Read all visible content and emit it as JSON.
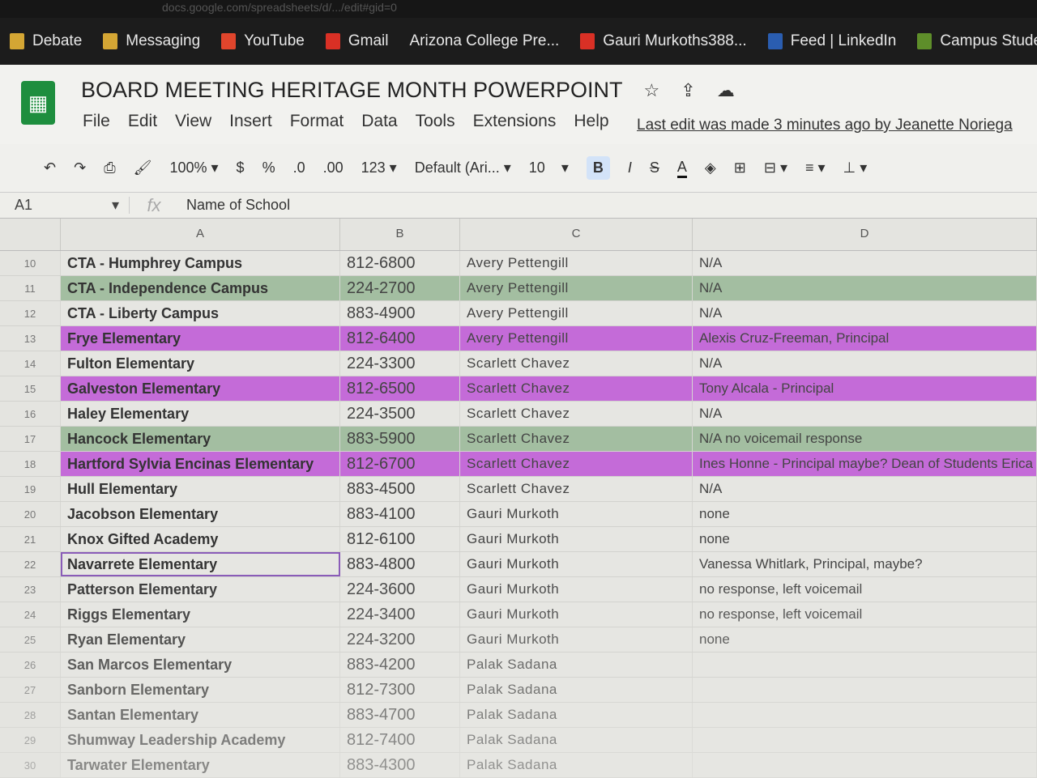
{
  "browser": {
    "url": "docs.google.com/spreadsheets/d/.../edit#gid=0",
    "bookmarks": [
      {
        "label": "Debate",
        "icon": "folder-icon",
        "color": "#d4a634"
      },
      {
        "label": "Messaging",
        "icon": "folder-icon",
        "color": "#d4a634"
      },
      {
        "label": "YouTube",
        "icon": "youtube-icon",
        "color": "#e0452c"
      },
      {
        "label": "Gmail",
        "icon": "gmail-icon",
        "color": "#d93025"
      },
      {
        "label": "Arizona College Pre...",
        "icon": "",
        "color": ""
      },
      {
        "label": "Gauri Murkoths388...",
        "icon": "gmail-icon",
        "color": "#d93025"
      },
      {
        "label": "Feed | LinkedIn",
        "icon": "linkedin-icon",
        "color": "#2a5db0"
      },
      {
        "label": "Campus Stude",
        "icon": "campus-icon",
        "color": "#5e8e2a"
      }
    ]
  },
  "doc": {
    "title": "BOARD MEETING HERITAGE MONTH POWERPOINT",
    "menu": [
      "File",
      "Edit",
      "View",
      "Insert",
      "Format",
      "Data",
      "Tools",
      "Extensions",
      "Help"
    ],
    "last_edit": "Last edit was made 3 minutes ago by Jeanette Noriega"
  },
  "toolbar": {
    "zoom": "100%",
    "currency": "$",
    "percent": "%",
    "dec_less": ".0",
    "dec_more": ".00",
    "format": "123",
    "font": "Default (Ari...",
    "size": "10",
    "bold": "B",
    "italic": "I",
    "strike": "S",
    "textcolor": "A"
  },
  "formula": {
    "cell": "A1",
    "fx": "fx",
    "value": "Name of School"
  },
  "columns": [
    "A",
    "B",
    "C",
    "D"
  ],
  "colors": {
    "purple": "#c46bd8",
    "green": "#a3bea1"
  },
  "rows": [
    {
      "n": "10",
      "a": "CTA - Humphrey Campus",
      "b": "812-6800",
      "c": "Avery Pettengill",
      "d": "N/A",
      "hl": ""
    },
    {
      "n": "11",
      "a": "CTA - Independence Campus",
      "b": "224-2700",
      "c": "Avery Pettengill",
      "d": "N/A",
      "hl": "green"
    },
    {
      "n": "12",
      "a": "CTA - Liberty Campus",
      "b": "883-4900",
      "c": "Avery Pettengill",
      "d": "N/A",
      "hl": ""
    },
    {
      "n": "13",
      "a": "Frye Elementary",
      "b": "812-6400",
      "c": "Avery Pettengill",
      "d": "Alexis Cruz-Freeman, Principal",
      "hl": "purple"
    },
    {
      "n": "14",
      "a": "Fulton Elementary",
      "b": "224-3300",
      "c": "Scarlett Chavez",
      "d": "N/A",
      "hl": ""
    },
    {
      "n": "15",
      "a": "Galveston Elementary",
      "b": "812-6500",
      "c": "Scarlett Chavez",
      "d": "Tony Alcala - Principal",
      "hl": "purple"
    },
    {
      "n": "16",
      "a": "Haley Elementary",
      "b": "224-3500",
      "c": "Scarlett Chavez",
      "d": "N/A",
      "hl": ""
    },
    {
      "n": "17",
      "a": "Hancock Elementary",
      "b": "883-5900",
      "c": "Scarlett Chavez",
      "d": "N/A no voicemail response",
      "hl": "green"
    },
    {
      "n": "18",
      "a": "Hartford Sylvia Encinas Elementary",
      "b": "812-6700",
      "c": "Scarlett Chavez",
      "d": "Ines Honne - Principal maybe? Dean of Students Erica C",
      "hl": "purple"
    },
    {
      "n": "19",
      "a": "Hull Elementary",
      "b": "883-4500",
      "c": "Scarlett Chavez",
      "d": "N/A",
      "hl": ""
    },
    {
      "n": "20",
      "a": "Jacobson Elementary",
      "b": "883-4100",
      "c": "Gauri Murkoth",
      "d": "none",
      "hl": ""
    },
    {
      "n": "21",
      "a": "Knox Gifted Academy",
      "b": "812-6100",
      "c": "Gauri Murkoth",
      "d": "none",
      "hl": ""
    },
    {
      "n": "22",
      "a": "Navarrete Elementary",
      "b": "883-4800",
      "c": "Gauri Murkoth",
      "d": "Vanessa Whitlark, Principal, maybe?",
      "hl": "sel"
    },
    {
      "n": "23",
      "a": "Patterson Elementary",
      "b": "224-3600",
      "c": "Gauri Murkoth",
      "d": "no response, left voicemail",
      "hl": ""
    },
    {
      "n": "24",
      "a": "Riggs Elementary",
      "b": "224-3400",
      "c": "Gauri Murkoth",
      "d": "no response, left voicemail",
      "hl": ""
    },
    {
      "n": "25",
      "a": "Ryan Elementary",
      "b": "224-3200",
      "c": "Gauri Murkoth",
      "d": "none",
      "hl": ""
    },
    {
      "n": "26",
      "a": "San Marcos Elementary",
      "b": "883-4200",
      "c": "Palak Sadana",
      "d": "",
      "hl": ""
    },
    {
      "n": "27",
      "a": "Sanborn Elementary",
      "b": "812-7300",
      "c": "Palak Sadana",
      "d": "",
      "hl": ""
    },
    {
      "n": "28",
      "a": "Santan Elementary",
      "b": "883-4700",
      "c": "Palak Sadana",
      "d": "",
      "hl": ""
    },
    {
      "n": "29",
      "a": "Shumway Leadership Academy",
      "b": "812-7400",
      "c": "Palak Sadana",
      "d": "",
      "hl": ""
    },
    {
      "n": "30",
      "a": "Tarwater Elementary",
      "b": "883-4300",
      "c": "Palak Sadana",
      "d": "",
      "hl": ""
    }
  ]
}
